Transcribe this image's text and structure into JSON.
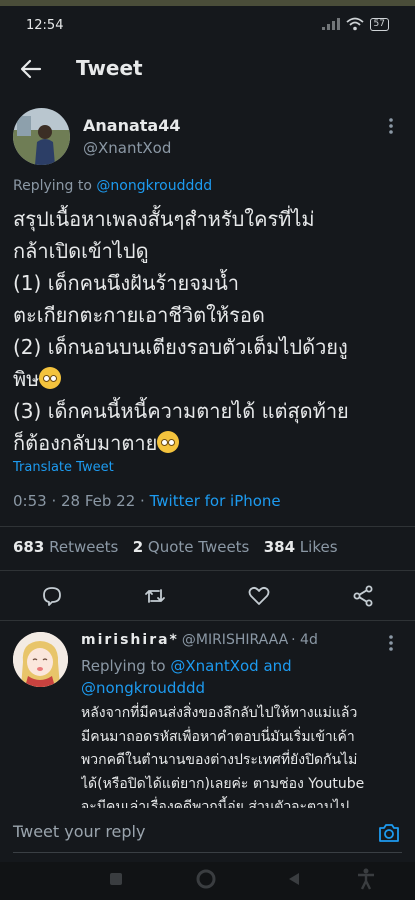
{
  "status_bar": {
    "time": "12:54",
    "battery": "57"
  },
  "header": {
    "title": "Tweet"
  },
  "tweet": {
    "author_name": "Ananata44",
    "author_handle": "@XnantXod",
    "replying_prefix": "Replying to ",
    "replying_to": "@nongkroudddd",
    "lines": [
      "สรุปเนื้อหาเพลงสั้นๆสำหรับใครที่ไม่",
      "กล้าเปิดเข้าไปดู",
      "(1) เด็กคนนึงฝันร้ายจมน้ำ",
      "ตะเกียกตะกายเอาชีวิตให้รอด",
      "(2) เด็กนอนบนเตียงรอบตัวเต็มไปด้วยงู",
      "พิษ",
      "(3) เด็กคนนี้หนี้ความตายได้ แต่สุดท้าย",
      "ก็ต้องกลับมาตาย"
    ],
    "translate": "Translate Tweet",
    "time": "0:53",
    "date": "28 Feb 22",
    "separator": " · ",
    "source": "Twitter for iPhone",
    "retweets_count": "683",
    "retweets_label": "Retweets",
    "quotes_count": "2",
    "quotes_label": "Quote Tweets",
    "likes_count": "384",
    "likes_label": "Likes"
  },
  "reply": {
    "author_name": "mirishira*",
    "author_handle": "@MIRISHIRAAA",
    "age": "· 4d",
    "replying_prefix": "Replying to ",
    "replying_to_1": "@XnantXod",
    "replying_and": " and",
    "replying_to_2": "@nongkroudddd",
    "lines": [
      "หลังจากที่มีคนส่งสิ่งของลึกลับไปให้ทางแม่แล้ว",
      "มีคนมาถอดรหัสเพื่อหาคำตอบนี่มันเริ่มเข้าเค้า",
      "พวกคดีในตำนานของต่างประเทศที่ยังปิดกันไม่",
      "ได้(หรือปิดได้แต่ยาก)เลยค่ะ ตามช่อง Youtube",
      "จะมีคนเล่าเรื่องคดีพวกนี้อ่ย ส่วนตัวจะตามไป"
    ]
  },
  "compose": {
    "placeholder": "Tweet your reply"
  },
  "icons": {
    "back": "back-arrow-icon",
    "more": "more-vertical-icon",
    "reply": "reply-icon",
    "retweet": "retweet-icon",
    "like": "heart-icon",
    "share": "share-icon",
    "camera": "camera-icon"
  },
  "colors": {
    "background": "#15181c",
    "accent": "#1d9bf0",
    "muted": "#8b98a5",
    "text": "#e7e9ea"
  }
}
